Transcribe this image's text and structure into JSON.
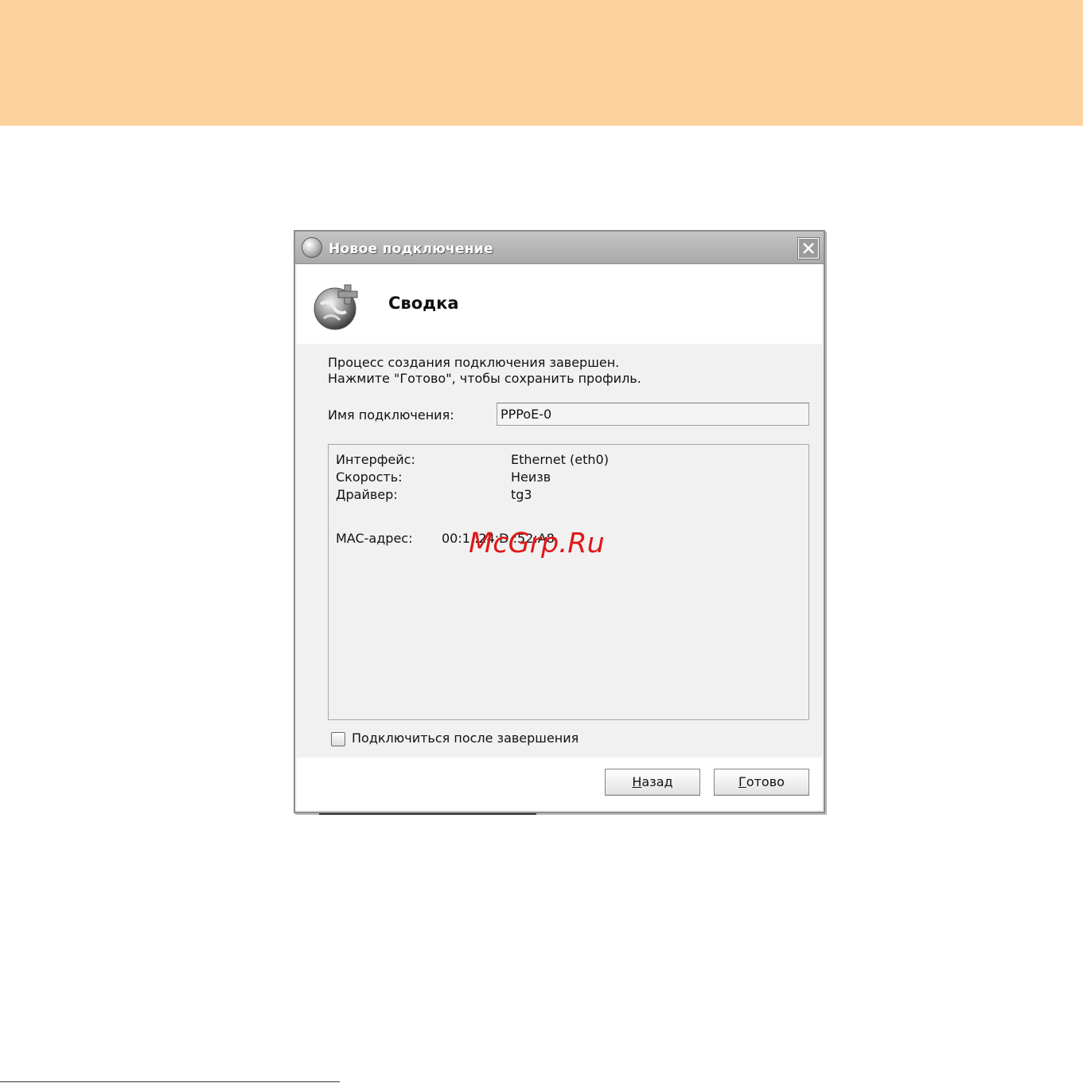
{
  "colors": {
    "top_band": "#fdd29e",
    "dialog_bg": "#f1f1f1",
    "titlebar": "#ababab",
    "watermark": "#e01818"
  },
  "window": {
    "title": "Новое подключение",
    "icon": "network-globe-icon",
    "close_icon": "close-icon"
  },
  "header": {
    "title": "Сводка",
    "icon": "new-connection-globe-plus-icon"
  },
  "intro": {
    "line1": "Процесс создания подключения завершен.",
    "line2": "Нажмите \"Готово\", чтобы сохранить профиль."
  },
  "connection_name": {
    "label": "Имя подключения:",
    "value": "PPPoE-0"
  },
  "details": {
    "interface_label": "Интерфейс:",
    "interface_value": "Ethernet (eth0)",
    "speed_label": "Скорость:",
    "speed_value": "Неизв",
    "driver_label": "Драйвер:",
    "driver_value": "tg3",
    "mac_label": "MAC-адрес:",
    "mac_value": "00:1 :24:D :52:A8"
  },
  "watermark": "McGrp.Ru",
  "connect_after": {
    "label": "Подключиться после завершения",
    "checked": false
  },
  "buttons": {
    "back_first_letter": "Н",
    "back_rest": "азад",
    "finish_first_letter": "Г",
    "finish_rest": "отово"
  }
}
